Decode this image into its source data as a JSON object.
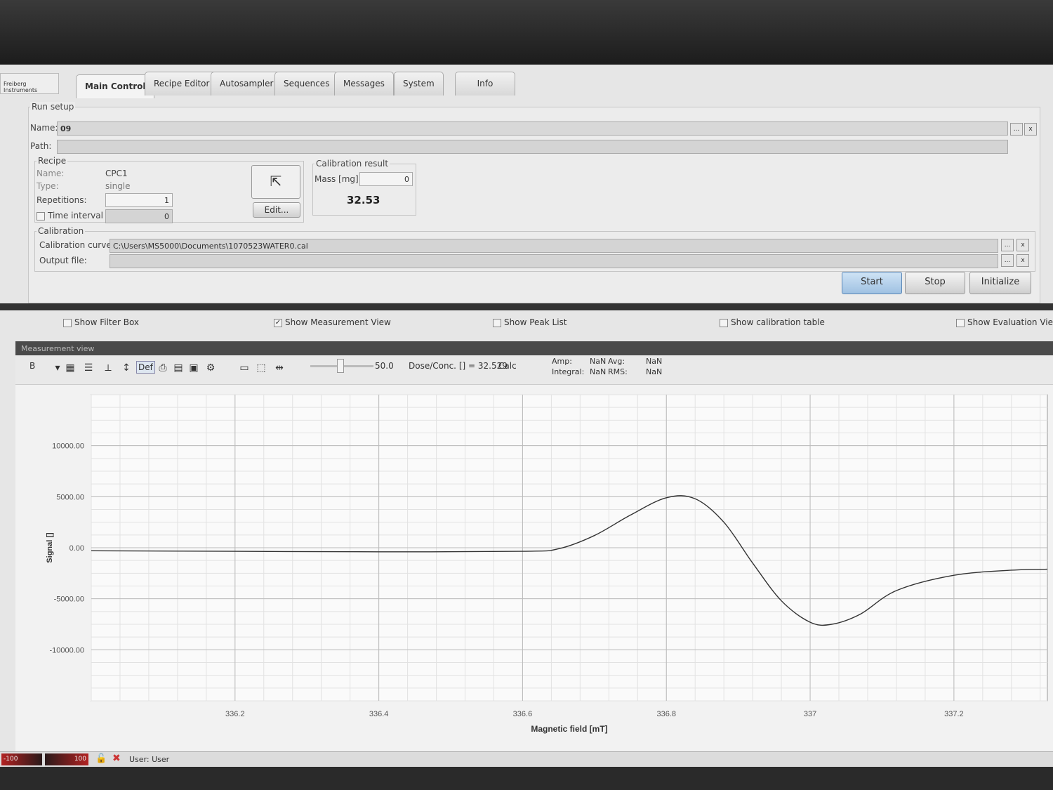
{
  "brand": "Freiberg Instruments",
  "tabs": [
    "Main Control",
    "Recipe Editor",
    "Autosampler",
    "Sequences",
    "Messages",
    "System",
    "Info"
  ],
  "run_setup": {
    "title": "Run setup",
    "name_label": "Name:",
    "name_value": "09",
    "path_label": "Path:",
    "path_value": "",
    "browse": "...",
    "clear": "x"
  },
  "recipe": {
    "title": "Recipe",
    "name_label": "Name:",
    "name_value": "CPC1",
    "type_label": "Type:",
    "type_value": "single",
    "repetitions_label": "Repetitions:",
    "repetitions_value": "1",
    "time_interval_label": "Time interval [s]:",
    "time_interval_value": "0",
    "time_interval_checked": false,
    "edit_label": "Edit..."
  },
  "calibration_result": {
    "title": "Calibration result",
    "mass_label": "Mass [mg]:",
    "mass_value": "0",
    "result": "32.53"
  },
  "calibration": {
    "title": "Calibration",
    "curve_label": "Calibration curve:",
    "curve_value": "C:\\Users\\MS5000\\Documents\\1070523WATER0.cal",
    "output_label": "Output file:",
    "output_value": ""
  },
  "actions": {
    "start": "Start",
    "stop": "Stop",
    "initialize": "Initialize"
  },
  "view_options": [
    {
      "label": "Show Filter Box",
      "checked": false
    },
    {
      "label": "Show Measurement View",
      "checked": true
    },
    {
      "label": "Show Peak List",
      "checked": false
    },
    {
      "label": "Show calibration table",
      "checked": false
    },
    {
      "label": "Show Evaluation Vie",
      "checked": false
    }
  ],
  "measurement_view": {
    "title": "Measurement view",
    "channel": "B",
    "def_label": "Def",
    "slider_value": "50.0",
    "dose_text": "Dose/Conc. [] = 32.529",
    "calc_label": "Calc",
    "stats": {
      "amp_label": "Amp:",
      "amp": "NaN",
      "avg_label": "Avg:",
      "avg": "NaN",
      "integral_label": "Integral:",
      "integral": "NaN",
      "rms_label": "RMS:",
      "rms": "NaN"
    }
  },
  "chart_data": {
    "type": "line",
    "xlabel": "Magnetic field [mT]",
    "ylabel": "Signal []",
    "xlim": [
      336.0,
      337.33
    ],
    "ylim": [
      -15000,
      15000
    ],
    "grid": true,
    "x_ticks": [
      "336.2",
      "336.4",
      "336.6",
      "336.8",
      "337",
      "337.2"
    ],
    "y_ticks": [
      "10000.00",
      "5000.00",
      "0.00",
      "-5000.00",
      "-10000.00"
    ],
    "series": [
      {
        "x": [
          336.0,
          336.2,
          336.4,
          336.6,
          336.65,
          336.7,
          336.75,
          336.8,
          336.84,
          336.88,
          336.92,
          336.96,
          337.0,
          337.03,
          337.07,
          337.12,
          337.2,
          337.28,
          337.33
        ],
        "y": [
          -300,
          -350,
          -400,
          -350,
          -100,
          1200,
          3200,
          4900,
          4800,
          2500,
          -1500,
          -5200,
          -7300,
          -7500,
          -6500,
          -4200,
          -2700,
          -2200,
          -2100
        ]
      }
    ]
  },
  "status": {
    "left_meter": "-100",
    "right_meter": "100",
    "user": "User: User"
  },
  "colors": {
    "curve": "#333333",
    "start_button": "#a9c8e6",
    "meter": "#b22222"
  }
}
